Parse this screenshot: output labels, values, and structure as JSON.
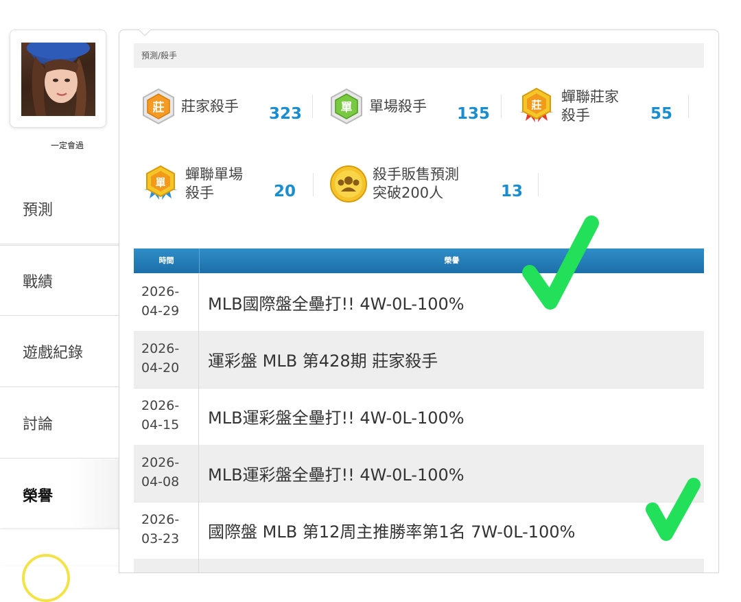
{
  "profile": {
    "username": "一定會過"
  },
  "nav": [
    {
      "label": "預測"
    },
    {
      "label": "戰績"
    },
    {
      "label": "遊戲紀錄"
    },
    {
      "label": "討論"
    },
    {
      "label": "榮譽",
      "active": true
    }
  ],
  "breadcrumb": "預測/殺手",
  "stats": [
    {
      "label": "莊家殺手",
      "value": "323",
      "icon": "zhuang-badge-icon"
    },
    {
      "label": "單場殺手",
      "value": "135",
      "icon": "dan-badge-icon"
    },
    {
      "label": "蟬聯莊家殺手",
      "value": "55",
      "icon": "zhuang-ribbon-badge-icon"
    },
    {
      "label": "蟬聯單場殺手",
      "value": "20",
      "icon": "dan-ribbon-badge-icon"
    },
    {
      "label": "殺手販售預測突破200人",
      "value": "13",
      "icon": "group-coin-icon"
    }
  ],
  "table": {
    "headers": [
      "時間",
      "榮譽"
    ],
    "rows": [
      {
        "date": "2026-04-29",
        "title": "MLB國際盤全壘打!! 4W-0L-100%"
      },
      {
        "date": "2026-04-20",
        "title": "運彩盤 MLB 第428期 莊家殺手"
      },
      {
        "date": "2026-04-15",
        "title": "MLB運彩盤全壘打!! 4W-0L-100%"
      },
      {
        "date": "2026-04-08",
        "title": "MLB運彩盤全壘打!! 4W-0L-100%"
      },
      {
        "date": "2026-03-23",
        "title": "國際盤 MLB 第12周主推勝率第1名 7W-0L-100%"
      }
    ]
  },
  "colors": {
    "accent": "#1a8cd0",
    "header_bg": "#1d6fa9",
    "check": "#22e05a"
  }
}
